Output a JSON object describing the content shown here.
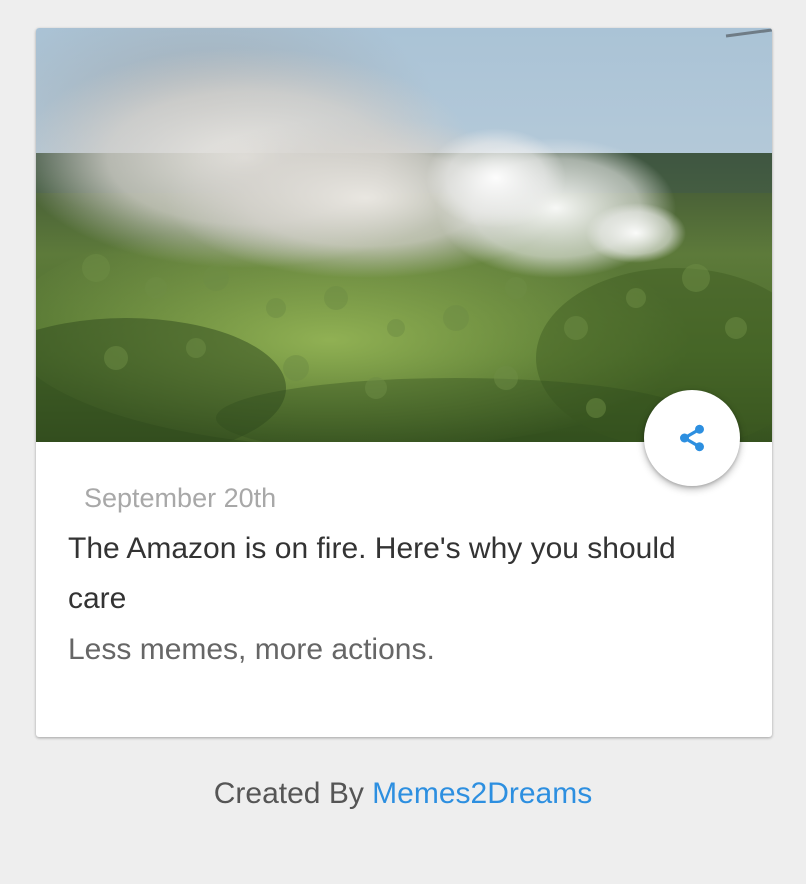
{
  "card": {
    "image_subject": "aerial view of smoke rising over burning Amazon rainforest",
    "date": "September 20th",
    "title": "The Amazon is on fire. Here's why you should care",
    "subtitle": "Less memes, more actions.",
    "share_icon": "share-icon",
    "accent_color": "#2d8fe0"
  },
  "footer": {
    "prefix": "Created By",
    "link_text": "Memes2Dreams",
    "link_color": "#2d8fe0"
  }
}
